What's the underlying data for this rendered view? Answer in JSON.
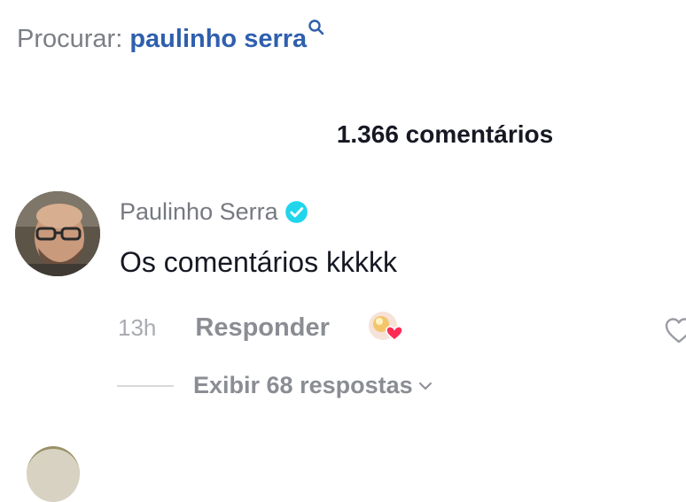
{
  "search": {
    "label": "Procurar:",
    "query": "paulinho serra",
    "icon": "search-icon"
  },
  "comments_header": {
    "count_text": "1.366 comentários"
  },
  "comment": {
    "username": "Paulinho Serra",
    "verified": true,
    "verified_color": "#20d5ec",
    "text": "Os comentários kkkkk",
    "time": "13h",
    "reply_label": "Responder",
    "view_replies_label": "Exibir 68 respostas",
    "creator_liked": true,
    "heart_color": "#fe2c55"
  }
}
